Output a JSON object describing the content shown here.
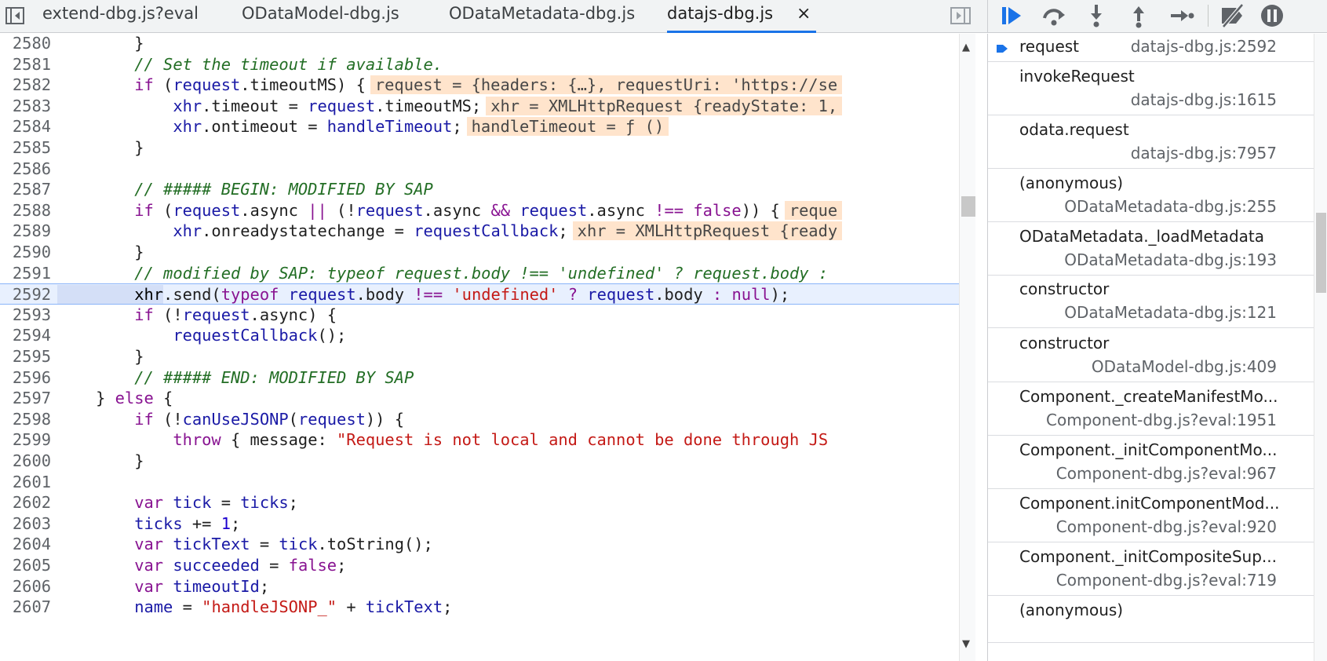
{
  "tabs": [
    {
      "label": "extend-dbg.js?eval",
      "active": false
    },
    {
      "label": "ODataModel-dbg.js",
      "active": false
    },
    {
      "label": "ODataMetadata-dbg.js",
      "active": false
    },
    {
      "label": "datajs-dbg.js",
      "active": true
    }
  ],
  "tab_close_glyph": "×",
  "colors": {
    "accent": "#1a73e8",
    "keyword": "#881391",
    "variable": "#1a1aa6",
    "string": "#c41a16",
    "comment": "#236e25",
    "inline_value_bg": "#ffe4cc",
    "execution_line_bg": "#e8f0fe"
  },
  "debug_toolbar": [
    {
      "name": "resume-icon"
    },
    {
      "name": "step-over-icon"
    },
    {
      "name": "step-into-icon"
    },
    {
      "name": "step-out-icon"
    },
    {
      "name": "step-icon"
    },
    {
      "name": "deactivate-breakpoints-icon"
    },
    {
      "name": "pause-on-exceptions-icon"
    }
  ],
  "code": {
    "execution_line": "2592",
    "lines": [
      {
        "n": "2580",
        "t": [
          {
            "c": "tx",
            "s": "        }"
          }
        ]
      },
      {
        "n": "2581",
        "t": [
          {
            "c": "com",
            "s": "        // Set the timeout if available."
          }
        ]
      },
      {
        "n": "2582",
        "t": [
          {
            "c": "kw",
            "s": "        if"
          },
          {
            "c": "tx",
            "s": " ("
          },
          {
            "c": "vr",
            "s": "request"
          },
          {
            "c": "tx",
            "s": ".timeoutMS) {"
          },
          {
            "c": "inl",
            "s": "request = {headers: {…}, requestUri: 'https://se"
          }
        ]
      },
      {
        "n": "2583",
        "t": [
          {
            "c": "vr",
            "s": "            xhr"
          },
          {
            "c": "tx",
            "s": ".timeout = "
          },
          {
            "c": "vr",
            "s": "request"
          },
          {
            "c": "tx",
            "s": ".timeoutMS;"
          },
          {
            "c": "inl",
            "s": "xhr = XMLHttpRequest {readyState: 1,"
          }
        ]
      },
      {
        "n": "2584",
        "t": [
          {
            "c": "vr",
            "s": "            xhr"
          },
          {
            "c": "tx",
            "s": ".ontimeout = "
          },
          {
            "c": "vr",
            "s": "handleTimeout"
          },
          {
            "c": "tx",
            "s": ";"
          },
          {
            "c": "inl",
            "s": "handleTimeout = ƒ ()"
          }
        ]
      },
      {
        "n": "2585",
        "t": [
          {
            "c": "tx",
            "s": "        }"
          }
        ]
      },
      {
        "n": "2586",
        "t": []
      },
      {
        "n": "2587",
        "t": [
          {
            "c": "com",
            "s": "        // ##### BEGIN: MODIFIED BY SAP"
          }
        ]
      },
      {
        "n": "2588",
        "t": [
          {
            "c": "kw",
            "s": "        if"
          },
          {
            "c": "tx",
            "s": " ("
          },
          {
            "c": "vr",
            "s": "request"
          },
          {
            "c": "tx",
            "s": ".async "
          },
          {
            "c": "kw",
            "s": "||"
          },
          {
            "c": "tx",
            "s": " (!"
          },
          {
            "c": "vr",
            "s": "request"
          },
          {
            "c": "tx",
            "s": ".async "
          },
          {
            "c": "kw",
            "s": "&&"
          },
          {
            "c": "tx",
            "s": " "
          },
          {
            "c": "vr",
            "s": "request"
          },
          {
            "c": "tx",
            "s": ".async "
          },
          {
            "c": "kw",
            "s": "!=="
          },
          {
            "c": "tx",
            "s": " "
          },
          {
            "c": "kw",
            "s": "false"
          },
          {
            "c": "tx",
            "s": ")) {"
          },
          {
            "c": "inl",
            "s": "reque"
          }
        ]
      },
      {
        "n": "2589",
        "t": [
          {
            "c": "vr",
            "s": "            xhr"
          },
          {
            "c": "tx",
            "s": ".onreadystatechange = "
          },
          {
            "c": "vr",
            "s": "requestCallback"
          },
          {
            "c": "tx",
            "s": ";"
          },
          {
            "c": "inl",
            "s": "xhr = XMLHttpRequest {ready"
          }
        ]
      },
      {
        "n": "2590",
        "t": [
          {
            "c": "tx",
            "s": "        }"
          }
        ]
      },
      {
        "n": "2591",
        "t": [
          {
            "c": "com",
            "s": "        // modified by SAP: typeof request.body !== 'undefined' ? request.body :"
          }
        ]
      },
      {
        "n": "2592",
        "t": [
          {
            "c": "hlw",
            "s": "        xhr"
          },
          {
            "c": "tx",
            "s": ".send("
          },
          {
            "c": "kw",
            "s": "typeof"
          },
          {
            "c": "tx",
            "s": " "
          },
          {
            "c": "vr",
            "s": "request"
          },
          {
            "c": "tx",
            "s": ".body "
          },
          {
            "c": "kw",
            "s": "!=="
          },
          {
            "c": "tx",
            "s": " "
          },
          {
            "c": "str",
            "s": "'undefined'"
          },
          {
            "c": "tx",
            "s": " "
          },
          {
            "c": "kw",
            "s": "?"
          },
          {
            "c": "tx",
            "s": " "
          },
          {
            "c": "vr",
            "s": "request"
          },
          {
            "c": "tx",
            "s": ".body "
          },
          {
            "c": "kw",
            "s": ":"
          },
          {
            "c": "tx",
            "s": " "
          },
          {
            "c": "kw",
            "s": "null"
          },
          {
            "c": "tx",
            "s": ");"
          }
        ]
      },
      {
        "n": "2593",
        "t": [
          {
            "c": "kw",
            "s": "        if"
          },
          {
            "c": "tx",
            "s": " (!"
          },
          {
            "c": "vr",
            "s": "request"
          },
          {
            "c": "tx",
            "s": ".async) {"
          }
        ]
      },
      {
        "n": "2594",
        "t": [
          {
            "c": "vr",
            "s": "            requestCallback"
          },
          {
            "c": "tx",
            "s": "();"
          }
        ]
      },
      {
        "n": "2595",
        "t": [
          {
            "c": "tx",
            "s": "        }"
          }
        ]
      },
      {
        "n": "2596",
        "t": [
          {
            "c": "com",
            "s": "        // ##### END: MODIFIED BY SAP"
          }
        ]
      },
      {
        "n": "2597",
        "t": [
          {
            "c": "tx",
            "s": "    } "
          },
          {
            "c": "kw",
            "s": "else"
          },
          {
            "c": "tx",
            "s": " {"
          }
        ]
      },
      {
        "n": "2598",
        "t": [
          {
            "c": "kw",
            "s": "        if"
          },
          {
            "c": "tx",
            "s": " (!"
          },
          {
            "c": "vr",
            "s": "canUseJSONP"
          },
          {
            "c": "tx",
            "s": "("
          },
          {
            "c": "vr",
            "s": "request"
          },
          {
            "c": "tx",
            "s": ")) {"
          }
        ]
      },
      {
        "n": "2599",
        "t": [
          {
            "c": "kw",
            "s": "            throw"
          },
          {
            "c": "tx",
            "s": " { message: "
          },
          {
            "c": "str",
            "s": "\"Request is not local and cannot be done through JS"
          }
        ]
      },
      {
        "n": "2600",
        "t": [
          {
            "c": "tx",
            "s": "        }"
          }
        ]
      },
      {
        "n": "2601",
        "t": []
      },
      {
        "n": "2602",
        "t": [
          {
            "c": "kw",
            "s": "        var"
          },
          {
            "c": "tx",
            "s": " "
          },
          {
            "c": "vr",
            "s": "tick"
          },
          {
            "c": "tx",
            "s": " = "
          },
          {
            "c": "vr",
            "s": "ticks"
          },
          {
            "c": "tx",
            "s": ";"
          }
        ]
      },
      {
        "n": "2603",
        "t": [
          {
            "c": "vr",
            "s": "        ticks"
          },
          {
            "c": "tx",
            "s": " += "
          },
          {
            "c": "num",
            "s": "1"
          },
          {
            "c": "tx",
            "s": ";"
          }
        ]
      },
      {
        "n": "2604",
        "t": [
          {
            "c": "kw",
            "s": "        var"
          },
          {
            "c": "tx",
            "s": " "
          },
          {
            "c": "vr",
            "s": "tickText"
          },
          {
            "c": "tx",
            "s": " = "
          },
          {
            "c": "vr",
            "s": "tick"
          },
          {
            "c": "tx",
            "s": ".toString();"
          }
        ]
      },
      {
        "n": "2605",
        "t": [
          {
            "c": "kw",
            "s": "        var"
          },
          {
            "c": "tx",
            "s": " "
          },
          {
            "c": "vr",
            "s": "succeeded"
          },
          {
            "c": "tx",
            "s": " = "
          },
          {
            "c": "kw",
            "s": "false"
          },
          {
            "c": "tx",
            "s": ";"
          }
        ]
      },
      {
        "n": "2606",
        "t": [
          {
            "c": "kw",
            "s": "        var"
          },
          {
            "c": "tx",
            "s": " "
          },
          {
            "c": "vr",
            "s": "timeoutId"
          },
          {
            "c": "tx",
            "s": ";"
          }
        ]
      },
      {
        "n": "2607",
        "t": [
          {
            "c": "vr",
            "s": "        name"
          },
          {
            "c": "tx",
            "s": " = "
          },
          {
            "c": "str",
            "s": "\"handleJSONP_\""
          },
          {
            "c": "tx",
            "s": " + "
          },
          {
            "c": "vr",
            "s": "tickText"
          },
          {
            "c": "tx",
            "s": ";"
          }
        ]
      }
    ]
  },
  "call_stack": [
    {
      "fn": "request",
      "loc": "datajs-dbg.js:2592",
      "current": true
    },
    {
      "fn": "invokeRequest",
      "loc": "datajs-dbg.js:1615"
    },
    {
      "fn": "odata.request",
      "loc": "datajs-dbg.js:7957"
    },
    {
      "fn": "(anonymous)",
      "loc": "ODataMetadata-dbg.js:255"
    },
    {
      "fn": "ODataMetadata._loadMetadata",
      "loc": "ODataMetadata-dbg.js:193"
    },
    {
      "fn": "constructor",
      "loc": "ODataMetadata-dbg.js:121"
    },
    {
      "fn": "constructor",
      "loc": "ODataModel-dbg.js:409"
    },
    {
      "fn": "Component._createManifestMo...",
      "loc": "Component-dbg.js?eval:1951"
    },
    {
      "fn": "Component._initComponentMo...",
      "loc": "Component-dbg.js?eval:967"
    },
    {
      "fn": "Component.initComponentMod...",
      "loc": "Component-dbg.js?eval:920"
    },
    {
      "fn": "Component._initCompositeSup...",
      "loc": "Component-dbg.js?eval:719"
    },
    {
      "fn": "(anonymous)",
      "loc": ""
    }
  ]
}
